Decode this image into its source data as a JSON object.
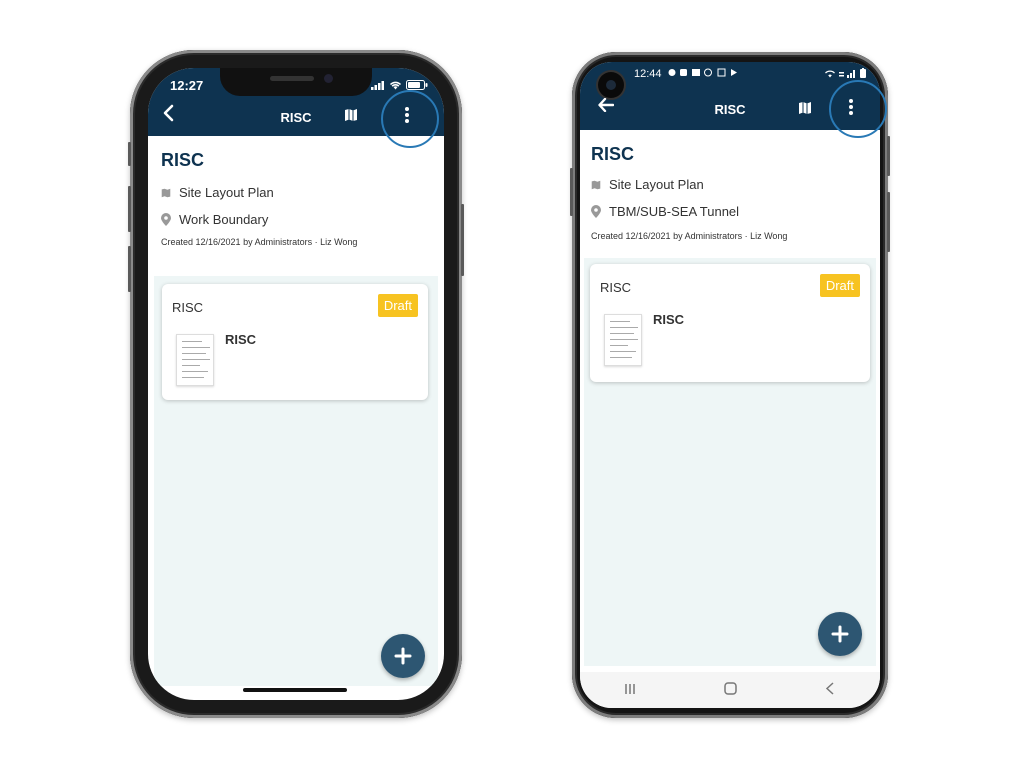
{
  "iphone": {
    "status_time": "12:27",
    "appbar_title": "RISC",
    "icons": {
      "back": "chevron-left-icon",
      "map": "map-icon",
      "more": "more-vertical-icon"
    },
    "doc_title": "RISC",
    "meta": [
      {
        "icon": "map-icon",
        "text": "Site Layout Plan"
      },
      {
        "icon": "location-pin-icon",
        "text": "Work Boundary"
      }
    ],
    "created": "Created 12/16/2021 by Administrators · Liz Wong",
    "card": {
      "title": "RISC",
      "badge": "Draft",
      "item_name": "RISC"
    },
    "fab": "plus-icon"
  },
  "android": {
    "status_time": "12:44",
    "appbar_title": "RISC",
    "icons": {
      "back": "arrow-left-icon",
      "map": "map-icon",
      "more": "more-vertical-icon"
    },
    "doc_title": "RISC",
    "meta": [
      {
        "icon": "map-icon",
        "text": "Site Layout Plan"
      },
      {
        "icon": "location-pin-icon",
        "text": "TBM/SUB-SEA Tunnel"
      }
    ],
    "created": "Created 12/16/2021 by Administrators · Liz Wong",
    "card": {
      "title": "RISC",
      "badge": "Draft",
      "item_name": "RISC"
    },
    "fab": "plus-icon",
    "navbar": [
      "recent-apps-icon",
      "home-icon",
      "back-icon"
    ]
  },
  "colors": {
    "appbar": "#0e3350",
    "badge": "#f7c321",
    "fab": "#2d5672",
    "highlight": "#2979b5",
    "panel": "#eef6f6"
  }
}
